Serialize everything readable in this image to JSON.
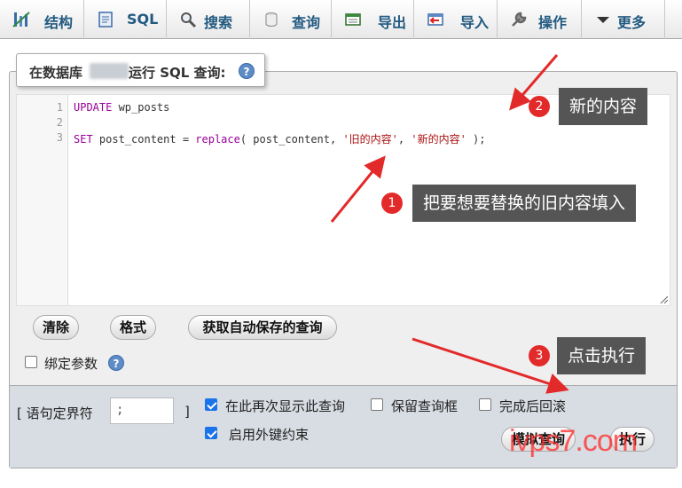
{
  "tabs": [
    {
      "label": "结构",
      "icon": "structure-icon"
    },
    {
      "label": "SQL",
      "icon": "sql-icon"
    },
    {
      "label": "搜索",
      "icon": "search-icon"
    },
    {
      "label": "查询",
      "icon": "query-icon"
    },
    {
      "label": "导出",
      "icon": "export-icon"
    },
    {
      "label": "导入",
      "icon": "import-icon"
    },
    {
      "label": "操作",
      "icon": "wrench-icon"
    },
    {
      "label": "更多",
      "icon": "caret-down-icon"
    }
  ],
  "query_box": {
    "title_prefix": "在数据库",
    "title_suffix": "运行 SQL 查询:",
    "help": "?"
  },
  "editor": {
    "line_numbers": [
      "1",
      "2",
      "3"
    ],
    "line1": {
      "kw": "UPDATE",
      "rest": " wp_posts"
    },
    "line3": {
      "kw1": "SET",
      "p1": " post_content = ",
      "kw2": "replace",
      "p2": "( post_content, ",
      "s1": "'旧的内容'",
      "p3": ", ",
      "s2": "'新的内容'",
      "p4": " );"
    }
  },
  "actions": {
    "clear": "清除",
    "format": "格式",
    "autosaved": "获取自动保存的查询"
  },
  "bind_params": {
    "label": "绑定参数",
    "checked": false
  },
  "footer": {
    "delimiter_label_open": "[ 语句定界符",
    "delimiter_value": ";",
    "delimiter_label_close": "]",
    "show_again": {
      "label": "在此再次显示此查询",
      "checked": true
    },
    "keep_box": {
      "label": "保留查询框",
      "checked": false
    },
    "rollback": {
      "label": "完成后回滚",
      "checked": false
    },
    "fk_checks": {
      "label": "启用外键约束",
      "checked": true
    },
    "simulate": "模拟查询",
    "go": "执行"
  },
  "annotations": {
    "note1": {
      "num": "1",
      "text": "把要想要替换的旧内容填入"
    },
    "note2": {
      "num": "2",
      "text": "新的内容"
    },
    "note3": {
      "num": "3",
      "text": "点击执行"
    },
    "arrow_color": "#e32a2a"
  },
  "watermark": "ivps7.com"
}
